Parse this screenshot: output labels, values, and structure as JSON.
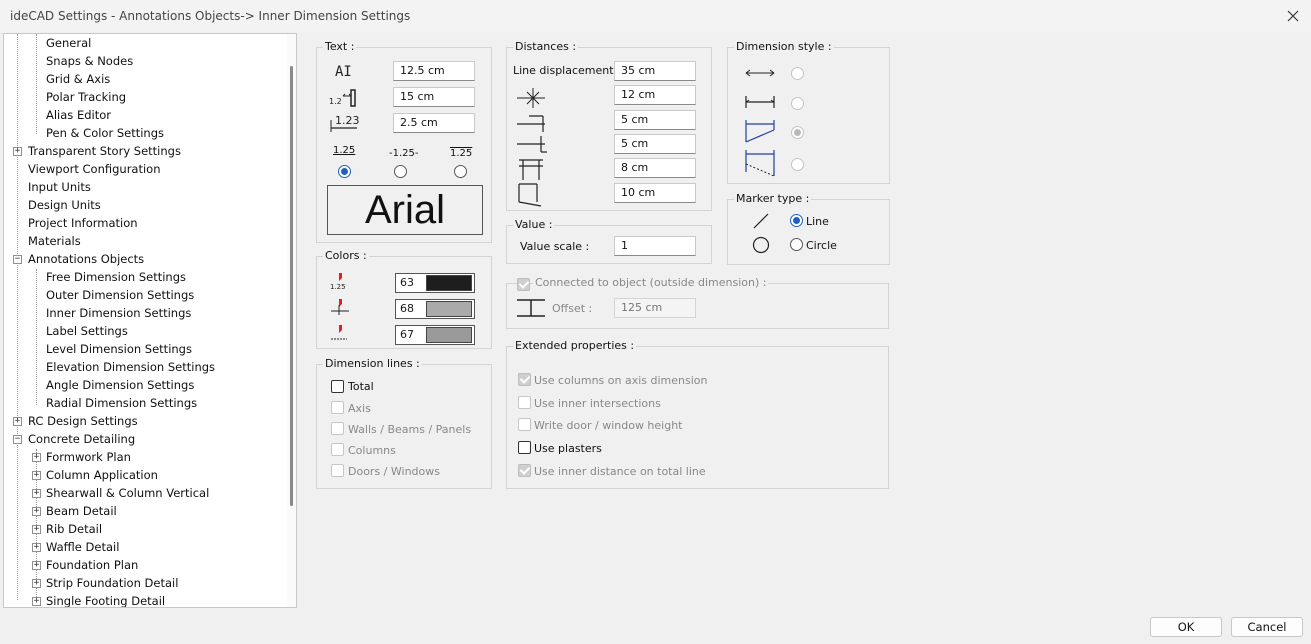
{
  "window": {
    "title": "ideCAD Settings - Annotations Objects-> Inner Dimension Settings"
  },
  "tree": {
    "items": [
      {
        "label": "General"
      },
      {
        "label": "Snaps & Nodes"
      },
      {
        "label": "Grid & Axis"
      },
      {
        "label": "Polar Tracking"
      },
      {
        "label": "Alias Editor"
      },
      {
        "label": "Pen & Color Settings"
      },
      {
        "label": "Transparent Story Settings"
      },
      {
        "label": "Viewport Configuration"
      },
      {
        "label": "Input Units"
      },
      {
        "label": "Design Units"
      },
      {
        "label": "Project Information"
      },
      {
        "label": "Materials"
      },
      {
        "label": "Annotations Objects"
      },
      {
        "label": "Free Dimension Settings"
      },
      {
        "label": "Outer Dimension Settings"
      },
      {
        "label": "Inner Dimension Settings"
      },
      {
        "label": "Label Settings"
      },
      {
        "label": "Level Dimension Settings"
      },
      {
        "label": "Elevation Dimension Settings"
      },
      {
        "label": "Angle Dimension Settings"
      },
      {
        "label": "Radial Dimension Settings"
      },
      {
        "label": "RC Design Settings"
      },
      {
        "label": "Concrete Detailing"
      },
      {
        "label": "Formwork Plan"
      },
      {
        "label": "Column Application"
      },
      {
        "label": "Shearwall & Column Vertical"
      },
      {
        "label": "Beam Detail"
      },
      {
        "label": "Rib Detail"
      },
      {
        "label": "Waffle Detail"
      },
      {
        "label": "Foundation Plan"
      },
      {
        "label": "Strip Foundation Detail"
      },
      {
        "label": "Single Footing Detail"
      }
    ]
  },
  "text_group": {
    "title": "Text :",
    "height_value": "12.5 cm",
    "offset_value": "15 cm",
    "spacing_value": "2.5 cm",
    "pos_labels": [
      "1.25",
      "-1.25-",
      "1.25"
    ],
    "font_name": "Arial"
  },
  "colors_group": {
    "title": "Colors :",
    "values": [
      "63",
      "68",
      "67"
    ],
    "swatches": [
      "#1e1e1e",
      "#aaaaaa",
      "#9a9a9a"
    ]
  },
  "dim_lines_group": {
    "title": "Dimension lines :",
    "items": [
      "Total",
      "Axis",
      "Walls / Beams / Panels",
      "Columns",
      "Doors / Windows"
    ]
  },
  "distances_group": {
    "title": "Distances :",
    "line_displacement_label": "Line displacement :",
    "values": [
      "35 cm",
      "12 cm",
      "5 cm",
      "5 cm",
      "8 cm",
      "10 cm"
    ]
  },
  "value_group": {
    "title": "Value :",
    "scale_label": "Value scale :",
    "scale_value": "1"
  },
  "connected_group": {
    "title": "Connected to object (outside dimension) :",
    "offset_label": "Offset :",
    "offset_value": "125 cm"
  },
  "extended_group": {
    "title": "Extended properties :",
    "items": [
      "Use columns on axis dimension",
      "Use inner intersections",
      "Write door / window height",
      "Use plasters",
      "Use inner distance on total line"
    ]
  },
  "dim_style_group": {
    "title": "Dimension style :"
  },
  "marker_group": {
    "title": "Marker type :",
    "line_label": "Line",
    "circle_label": "Circle"
  },
  "footer": {
    "ok_label": "OK",
    "cancel_label": "Cancel"
  }
}
